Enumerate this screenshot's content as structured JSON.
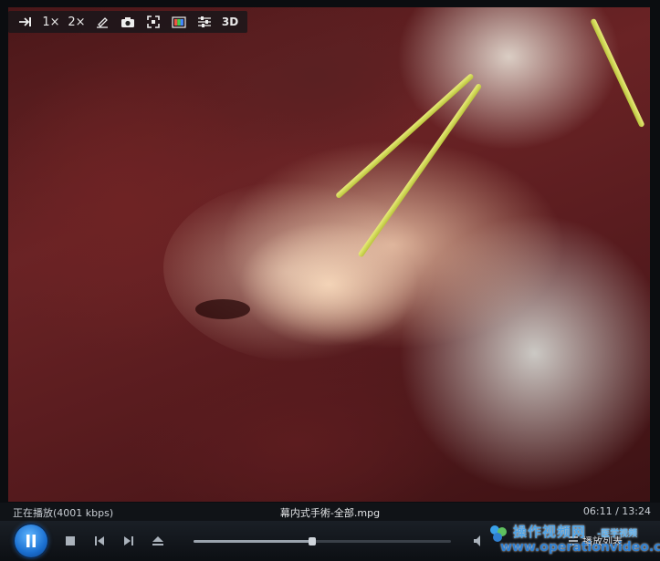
{
  "video": {
    "description_icon": "surgical-video-frame"
  },
  "toolbar": {
    "buttons": [
      {
        "name": "fit-window-button",
        "icon": "arrow-to-bar-icon",
        "label": ""
      },
      {
        "name": "zoom-1x-button",
        "icon": "",
        "label": "1×"
      },
      {
        "name": "zoom-2x-button",
        "icon": "",
        "label": "2×"
      },
      {
        "name": "edit-button",
        "icon": "pen-icon",
        "label": ""
      },
      {
        "name": "snapshot-button",
        "icon": "camera-icon",
        "label": ""
      },
      {
        "name": "fullscreen-button",
        "icon": "focus-frame-icon",
        "label": ""
      },
      {
        "name": "color-button",
        "icon": "color-palette-icon",
        "label": ""
      },
      {
        "name": "settings-button",
        "icon": "sliders-icon",
        "label": ""
      },
      {
        "name": "3d-button",
        "icon": "",
        "label": "3D"
      }
    ]
  },
  "status": {
    "state": "正在播放(4001 kbps)",
    "filename": "幕内式手術-全部.mpg",
    "time": "06:11 / 13:24"
  },
  "controls": {
    "progress_fraction": 0.46,
    "playlist_label": "播放列表"
  },
  "watermark": {
    "title": "操作视频网",
    "sub": "-医学视频",
    "url": "www.operationvideo.com"
  },
  "colors": {
    "accent": "#1a6fd0",
    "background": "#0b0d10"
  }
}
